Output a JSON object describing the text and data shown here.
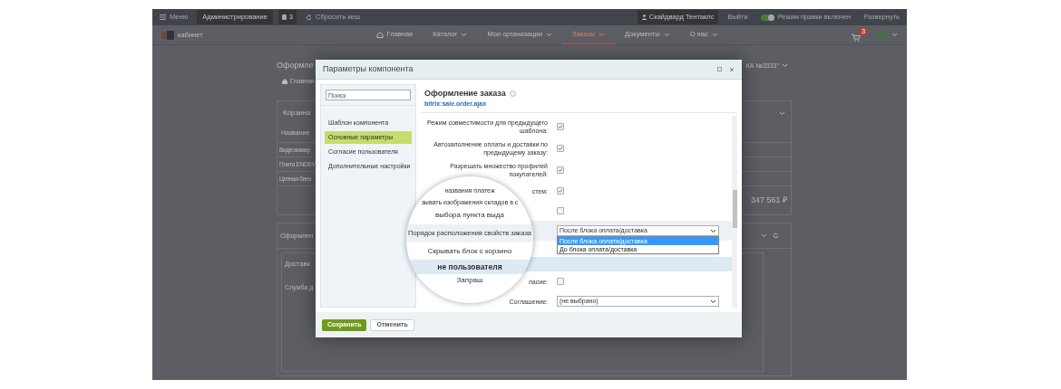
{
  "topbar": {
    "menu": "Меню",
    "admin": "Администрирование",
    "notifications": "3",
    "cache": "Сбросить кеш",
    "user": "Скайдвард Тентаклс",
    "logout": "Выйти",
    "edit_mode": {
      "label": "Режим правки включен",
      "on": true
    },
    "expand": "Развернуть"
  },
  "header": {
    "logo_text": "кабинет",
    "nav": [
      {
        "label": "Главная",
        "kind": "home",
        "selected": false
      },
      {
        "label": "Каталог",
        "kind": "menu",
        "selected": false
      },
      {
        "label": "Мои организации",
        "kind": "menu",
        "selected": false
      },
      {
        "label": "Заказы",
        "kind": "menu",
        "selected": true
      },
      {
        "label": "Документы",
        "kind": "menu",
        "selected": false
      },
      {
        "label": "О нас",
        "kind": "menu",
        "selected": false
      }
    ],
    "cart_badge": "3"
  },
  "page": {
    "title": "Оформле",
    "title_right": "КА №3333\"",
    "breadcrumb": "Главная",
    "basket": {
      "title": "Корзина",
      "column": "Название",
      "rows": [
        "Видеокамер",
        "Плита ENDEV",
        "Цепная бенз"
      ],
      "total": "347 561 ₽"
    },
    "checkout": {
      "title": "Оформлен",
      "delivery": "Доставк",
      "service": "Служба д"
    }
  },
  "dialog": {
    "title": "Параметры компонента",
    "search": {
      "placeholder": "Поиск"
    },
    "nav": [
      {
        "label": "Шаблон компонента",
        "selected": false
      },
      {
        "label": "Основные параметры",
        "selected": true
      },
      {
        "label": "Согласие пользователя",
        "selected": false
      },
      {
        "label": "Дополнительные настройки",
        "selected": false
      }
    ],
    "component_title": "Оформление заказа",
    "component_code": "bitrix:sale.order.ajax",
    "rows": [
      {
        "kind": "checkbox",
        "label": "Режим совместимости для предыдущего шаблона:",
        "checked": true
      },
      {
        "kind": "checkbox",
        "label": "Автозаполнение оплаты и доставки по предыдущему заказу:",
        "checked": true
      },
      {
        "kind": "checkbox",
        "label": "Разрешать множество профилей покупателей:",
        "checked": true
      },
      {
        "kind": "checkbox",
        "label": "стем:",
        "checked": true
      },
      {
        "kind": "checkbox",
        "checked": false
      },
      {
        "kind": "select",
        "shaded": true,
        "value": "После блока оплата/доставка",
        "options": [
          {
            "label": "После блока оплата/доставка",
            "selected": true
          },
          {
            "label": "До блока оплата/доставка",
            "selected": false
          }
        ]
      },
      {
        "kind": "section"
      },
      {
        "kind": "checkbox",
        "label": "ласие:",
        "checked": false
      },
      {
        "kind": "select",
        "label": "Соглашение:",
        "value": "(не выбрано)"
      }
    ],
    "magnifier": [
      {
        "kind": "fragment",
        "text": "названия платеж"
      },
      {
        "kind": "fragment",
        "text": "зывать изображения складов в с"
      },
      {
        "kind": "label",
        "text": "выбора пункта выда"
      },
      {
        "kind": "shaded",
        "text": "Порядок расположения свойств заказа"
      },
      {
        "kind": "label",
        "text": "Скрывать блок с корзино"
      },
      {
        "kind": "section",
        "text": "не пользователя"
      },
      {
        "kind": "label",
        "text": "Запраш"
      }
    ],
    "buttons": [
      {
        "label": "Сохранить",
        "kind": "primary"
      },
      {
        "label": "Отменить",
        "kind": "secondary"
      }
    ]
  }
}
